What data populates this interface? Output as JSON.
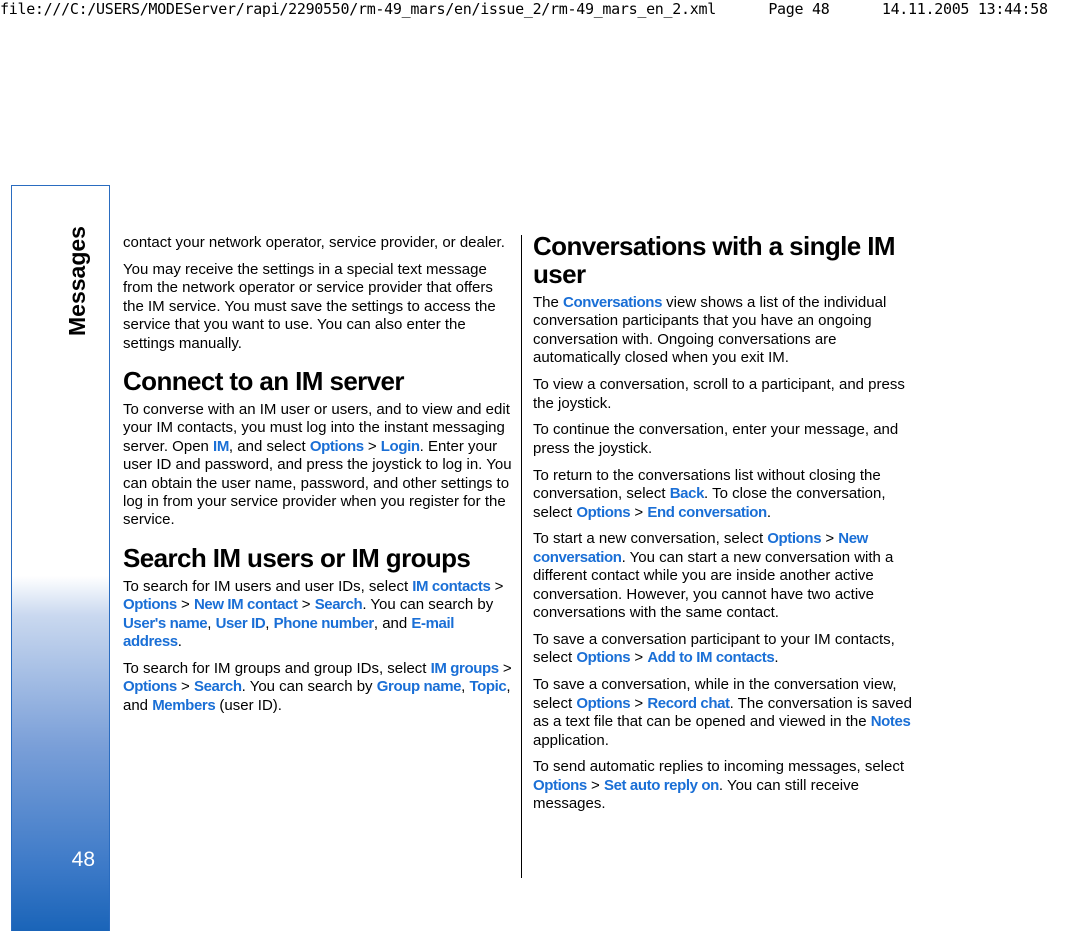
{
  "header": {
    "path": "file:///C:/USERS/MODEServer/rapi/2290550/rm-49_mars/en/issue_2/rm-49_mars_en_2.xml",
    "page": "Page 48",
    "timestamp": "14.11.2005 13:44:58"
  },
  "sidebar": {
    "section": "Messages",
    "page_number": "48"
  },
  "colors": {
    "link": "#1a6fd6",
    "sidebar": "#1a64b8"
  },
  "left_column": [
    {
      "type": "p",
      "segments": [
        {
          "t": "contact your network operator, service provider, or dealer."
        }
      ]
    },
    {
      "type": "p",
      "segments": [
        {
          "t": "You may receive the settings in a special text message from the network operator or service provider that offers the IM service. You must save the settings to access the service that you want to use. You can also enter the settings manually."
        }
      ]
    },
    {
      "type": "h2",
      "segments": [
        {
          "t": "Connect to an IM server"
        }
      ]
    },
    {
      "type": "p",
      "segments": [
        {
          "t": "To converse with an IM user or users, and to view and edit your IM contacts, you must log into the instant messaging server. Open "
        },
        {
          "t": "IM",
          "link": true
        },
        {
          "t": ", and select "
        },
        {
          "t": "Options",
          "link": true
        },
        {
          "t": " > "
        },
        {
          "t": "Login",
          "link": true
        },
        {
          "t": ". Enter your user ID and password, and press the joystick to log in. You can obtain the user name, password, and other settings to log in from your service provider when you register for the service."
        }
      ]
    },
    {
      "type": "h2",
      "segments": [
        {
          "t": "Search IM users or IM groups"
        }
      ]
    },
    {
      "type": "p",
      "segments": [
        {
          "t": "To search for IM users and user IDs, select "
        },
        {
          "t": "IM contacts",
          "link": true
        },
        {
          "t": " > "
        },
        {
          "t": "Options",
          "link": true
        },
        {
          "t": " > "
        },
        {
          "t": "New IM contact",
          "link": true
        },
        {
          "t": " > "
        },
        {
          "t": "Search",
          "link": true
        },
        {
          "t": ". You can search by "
        },
        {
          "t": "User's name",
          "link": true
        },
        {
          "t": ", "
        },
        {
          "t": "User ID",
          "link": true
        },
        {
          "t": ", "
        },
        {
          "t": "Phone number",
          "link": true
        },
        {
          "t": ", and "
        },
        {
          "t": "E-mail address",
          "link": true
        },
        {
          "t": "."
        }
      ]
    },
    {
      "type": "p",
      "segments": [
        {
          "t": "To search for IM groups and group IDs, select "
        },
        {
          "t": "IM groups",
          "link": true
        },
        {
          "t": " > "
        },
        {
          "t": "Options",
          "link": true
        },
        {
          "t": " > "
        },
        {
          "t": "Search",
          "link": true
        },
        {
          "t": ". You can search by "
        },
        {
          "t": "Group name",
          "link": true
        },
        {
          "t": ", "
        },
        {
          "t": "Topic",
          "link": true
        },
        {
          "t": ", and "
        },
        {
          "t": "Members",
          "link": true
        },
        {
          "t": " (user ID)."
        }
      ]
    }
  ],
  "right_column": [
    {
      "type": "h2",
      "segments": [
        {
          "t": "Conversations with a single IM user"
        }
      ]
    },
    {
      "type": "p",
      "segments": [
        {
          "t": "The "
        },
        {
          "t": "Conversations",
          "link": true
        },
        {
          "t": " view shows a list of the individual conversation participants that you have an ongoing conversation with. Ongoing conversations are automatically closed when you exit IM."
        }
      ]
    },
    {
      "type": "p",
      "segments": [
        {
          "t": "To view a conversation, scroll to a participant, and press the joystick."
        }
      ]
    },
    {
      "type": "p",
      "segments": [
        {
          "t": "To continue the conversation, enter your message, and press the joystick."
        }
      ]
    },
    {
      "type": "p",
      "segments": [
        {
          "t": "To return to the conversations list without closing the conversation, select "
        },
        {
          "t": "Back",
          "link": true
        },
        {
          "t": ". To close the conversation, select "
        },
        {
          "t": "Options",
          "link": true
        },
        {
          "t": " > "
        },
        {
          "t": "End conversation",
          "link": true
        },
        {
          "t": "."
        }
      ]
    },
    {
      "type": "p",
      "segments": [
        {
          "t": "To start a new conversation, select "
        },
        {
          "t": "Options",
          "link": true
        },
        {
          "t": " > "
        },
        {
          "t": "New conversation",
          "link": true
        },
        {
          "t": ". You can start a new conversation with a different contact while you are inside another active conversation. However, you cannot have two active conversations with the same contact."
        }
      ]
    },
    {
      "type": "p",
      "segments": [
        {
          "t": "To save a conversation participant to your IM contacts, select "
        },
        {
          "t": "Options",
          "link": true
        },
        {
          "t": " > "
        },
        {
          "t": "Add to IM contacts",
          "link": true
        },
        {
          "t": "."
        }
      ]
    },
    {
      "type": "p",
      "segments": [
        {
          "t": "To save a conversation, while in the conversation view, select "
        },
        {
          "t": "Options",
          "link": true
        },
        {
          "t": " > "
        },
        {
          "t": "Record chat",
          "link": true
        },
        {
          "t": ". The conversation is saved as a text file that can be opened and viewed in the "
        },
        {
          "t": "Notes",
          "link": true
        },
        {
          "t": " application."
        }
      ]
    },
    {
      "type": "p",
      "segments": [
        {
          "t": "To send automatic replies to incoming messages, select "
        },
        {
          "t": "Options",
          "link": true
        },
        {
          "t": " > "
        },
        {
          "t": "Set auto reply on",
          "link": true
        },
        {
          "t": ". You can still receive messages."
        }
      ]
    }
  ]
}
